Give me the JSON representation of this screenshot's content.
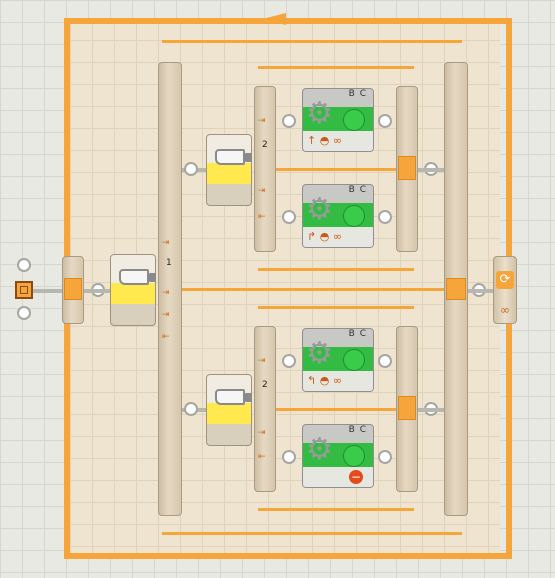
{
  "colors": {
    "wire": "#f6a53a",
    "switch": "#ffe94f",
    "motor": "#33bb44"
  },
  "top_switch": {
    "case_count": "1"
  },
  "upper_switch": {
    "case_count": "2"
  },
  "lower_switch": {
    "case_count": "2"
  },
  "motors": [
    {
      "ports": "B C",
      "direction_icon": "arrow-up-icon",
      "duration_icon": "infinity-icon",
      "duration": "∞"
    },
    {
      "ports": "B C",
      "direction_icon": "turn-right-icon",
      "duration_icon": "infinity-icon",
      "duration": "∞"
    },
    {
      "ports": "B C",
      "direction_icon": "turn-left-icon",
      "duration_icon": "infinity-icon",
      "duration": "∞"
    },
    {
      "ports": "B C",
      "direction_icon": "stop-icon",
      "duration_icon": "stop-icon",
      "duration": ""
    }
  ],
  "loop": {
    "control_icon": "loop-arrows-icon",
    "count": "∞"
  }
}
